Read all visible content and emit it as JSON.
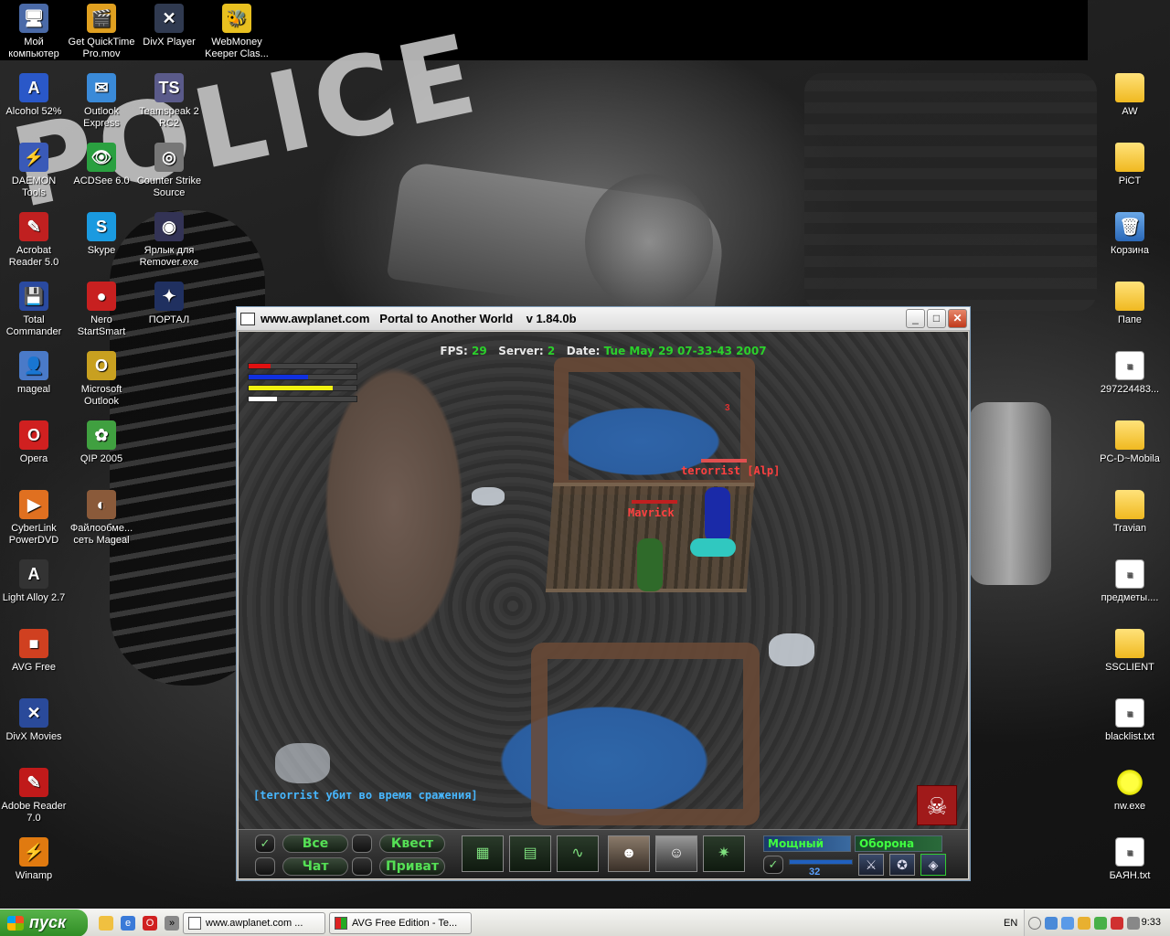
{
  "desktop": {
    "left_icons": [
      {
        "label": "Мой компьютер",
        "glyph": "🖥"
      },
      {
        "label": "Get QuickTime Pro.mov",
        "glyph": "🎬"
      },
      {
        "label": "DivX Player",
        "glyph": "✕"
      },
      {
        "label": "WebMoney Keeper Clas...",
        "glyph": "🐝"
      },
      {
        "label": "Alcohol 52%",
        "glyph": "A"
      },
      {
        "label": "Outlook Express",
        "glyph": "✉"
      },
      {
        "label": "Teamspeak 2 RC2",
        "glyph": "TS"
      },
      {
        "label": "DAEMON Tools",
        "glyph": "⚡"
      },
      {
        "label": "ACDSee 6.0",
        "glyph": "👁"
      },
      {
        "label": "Counter Strike Source",
        "glyph": "◎"
      },
      {
        "label": "Acrobat Reader 5.0",
        "glyph": "✎"
      },
      {
        "label": "Skype",
        "glyph": "S"
      },
      {
        "label": "Ярлык для Remover.exe",
        "glyph": "◉"
      },
      {
        "label": "Total Commander",
        "glyph": "💾"
      },
      {
        "label": "Nero StartSmart",
        "glyph": "●"
      },
      {
        "label": "ПОРТАЛ",
        "glyph": "✦"
      },
      {
        "label": "mageal",
        "glyph": "👤"
      },
      {
        "label": "Microsoft Outlook",
        "glyph": "O"
      },
      {
        "label": "Opera",
        "glyph": "O"
      },
      {
        "label": "QIP 2005",
        "glyph": "✿"
      },
      {
        "label": "CyberLink PowerDVD",
        "glyph": "▶"
      },
      {
        "label": "Файлообме... сеть Mageal",
        "glyph": "◐"
      },
      {
        "label": "Light Alloy 2.7",
        "glyph": "A"
      },
      {
        "label": "AVG Free",
        "glyph": "■"
      },
      {
        "label": "DivX Movies",
        "glyph": "✕"
      },
      {
        "label": "Adobe Reader 7.0",
        "glyph": "✎"
      },
      {
        "label": "Winamp",
        "glyph": "⚡"
      }
    ],
    "right_icons": [
      {
        "label": "AW",
        "kind": "folder"
      },
      {
        "label": "PiCT",
        "kind": "folder"
      },
      {
        "label": "Корзина",
        "kind": "bin"
      },
      {
        "label": "Папе",
        "kind": "folder"
      },
      {
        "label": "297224483...",
        "kind": "file"
      },
      {
        "label": "PC-D~Mobila",
        "kind": "folder"
      },
      {
        "label": "Travian",
        "kind": "folder"
      },
      {
        "label": "предметы....",
        "kind": "file"
      },
      {
        "label": "SSCLIENT",
        "kind": "folder"
      },
      {
        "label": "blacklist.txt",
        "kind": "file"
      },
      {
        "label": "nw.exe",
        "kind": "sun"
      },
      {
        "label": "БАЯН.txt",
        "kind": "file"
      }
    ]
  },
  "window": {
    "title": "www.awplanet.com   Portal to Another World    v 1.84.0b",
    "min": "_",
    "max": "□",
    "close": "✕"
  },
  "hud": {
    "fps_label": "FPS:",
    "fps": "29",
    "server_label": "Server:",
    "server": "2",
    "date_label": "Date:",
    "date": "Tue May 29 07-33-43 2007",
    "bars": [
      {
        "name": "health",
        "color": "#e01010",
        "fill": 0.2
      },
      {
        "name": "mana",
        "color": "#1030e0",
        "fill": 0.55
      },
      {
        "name": "stamina",
        "color": "#f0f010",
        "fill": 0.78
      },
      {
        "name": "exp",
        "color": "#ffffff",
        "fill": 0.26
      }
    ],
    "enemy_name": "terorrist [Alp]",
    "player_name": "Mavrick",
    "damage": "3",
    "chat_message": "[terorrist убит во время сражения]"
  },
  "panel": {
    "check": "✓",
    "all": "Все",
    "quest": "Квест",
    "chat": "Чат",
    "private": "Приват",
    "mode_power": "Мощный",
    "mode_defense": "Оборона",
    "counter": "32"
  },
  "taskbar": {
    "start": "пуск",
    "tasks": [
      "www.awplanet.com ...",
      "AVG Free Edition - Te..."
    ],
    "lang": "EN",
    "time": "9:33"
  }
}
